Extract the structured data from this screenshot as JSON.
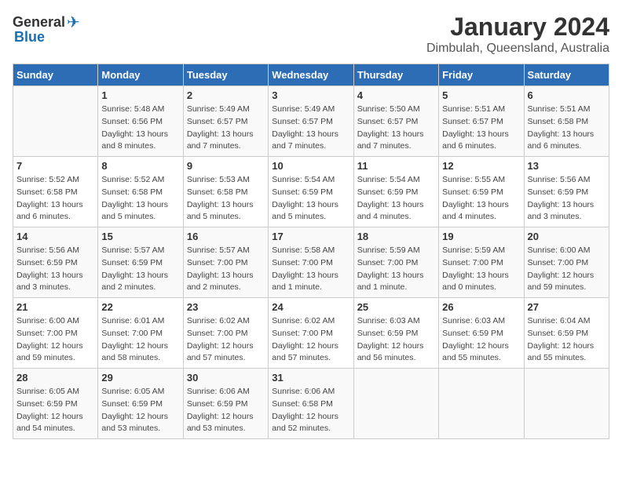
{
  "header": {
    "logo": {
      "general": "General",
      "blue": "Blue"
    },
    "title": "January 2024",
    "location": "Dimbulah, Queensland, Australia"
  },
  "calendar": {
    "days_of_week": [
      "Sunday",
      "Monday",
      "Tuesday",
      "Wednesday",
      "Thursday",
      "Friday",
      "Saturday"
    ],
    "weeks": [
      [
        {
          "day": "",
          "info": ""
        },
        {
          "day": "1",
          "info": "Sunrise: 5:48 AM\nSunset: 6:56 PM\nDaylight: 13 hours\nand 8 minutes."
        },
        {
          "day": "2",
          "info": "Sunrise: 5:49 AM\nSunset: 6:57 PM\nDaylight: 13 hours\nand 7 minutes."
        },
        {
          "day": "3",
          "info": "Sunrise: 5:49 AM\nSunset: 6:57 PM\nDaylight: 13 hours\nand 7 minutes."
        },
        {
          "day": "4",
          "info": "Sunrise: 5:50 AM\nSunset: 6:57 PM\nDaylight: 13 hours\nand 7 minutes."
        },
        {
          "day": "5",
          "info": "Sunrise: 5:51 AM\nSunset: 6:57 PM\nDaylight: 13 hours\nand 6 minutes."
        },
        {
          "day": "6",
          "info": "Sunrise: 5:51 AM\nSunset: 6:58 PM\nDaylight: 13 hours\nand 6 minutes."
        }
      ],
      [
        {
          "day": "7",
          "info": "Sunrise: 5:52 AM\nSunset: 6:58 PM\nDaylight: 13 hours\nand 6 minutes."
        },
        {
          "day": "8",
          "info": "Sunrise: 5:52 AM\nSunset: 6:58 PM\nDaylight: 13 hours\nand 5 minutes."
        },
        {
          "day": "9",
          "info": "Sunrise: 5:53 AM\nSunset: 6:58 PM\nDaylight: 13 hours\nand 5 minutes."
        },
        {
          "day": "10",
          "info": "Sunrise: 5:54 AM\nSunset: 6:59 PM\nDaylight: 13 hours\nand 5 minutes."
        },
        {
          "day": "11",
          "info": "Sunrise: 5:54 AM\nSunset: 6:59 PM\nDaylight: 13 hours\nand 4 minutes."
        },
        {
          "day": "12",
          "info": "Sunrise: 5:55 AM\nSunset: 6:59 PM\nDaylight: 13 hours\nand 4 minutes."
        },
        {
          "day": "13",
          "info": "Sunrise: 5:56 AM\nSunset: 6:59 PM\nDaylight: 13 hours\nand 3 minutes."
        }
      ],
      [
        {
          "day": "14",
          "info": "Sunrise: 5:56 AM\nSunset: 6:59 PM\nDaylight: 13 hours\nand 3 minutes."
        },
        {
          "day": "15",
          "info": "Sunrise: 5:57 AM\nSunset: 6:59 PM\nDaylight: 13 hours\nand 2 minutes."
        },
        {
          "day": "16",
          "info": "Sunrise: 5:57 AM\nSunset: 7:00 PM\nDaylight: 13 hours\nand 2 minutes."
        },
        {
          "day": "17",
          "info": "Sunrise: 5:58 AM\nSunset: 7:00 PM\nDaylight: 13 hours\nand 1 minute."
        },
        {
          "day": "18",
          "info": "Sunrise: 5:59 AM\nSunset: 7:00 PM\nDaylight: 13 hours\nand 1 minute."
        },
        {
          "day": "19",
          "info": "Sunrise: 5:59 AM\nSunset: 7:00 PM\nDaylight: 13 hours\nand 0 minutes."
        },
        {
          "day": "20",
          "info": "Sunrise: 6:00 AM\nSunset: 7:00 PM\nDaylight: 12 hours\nand 59 minutes."
        }
      ],
      [
        {
          "day": "21",
          "info": "Sunrise: 6:00 AM\nSunset: 7:00 PM\nDaylight: 12 hours\nand 59 minutes."
        },
        {
          "day": "22",
          "info": "Sunrise: 6:01 AM\nSunset: 7:00 PM\nDaylight: 12 hours\nand 58 minutes."
        },
        {
          "day": "23",
          "info": "Sunrise: 6:02 AM\nSunset: 7:00 PM\nDaylight: 12 hours\nand 57 minutes."
        },
        {
          "day": "24",
          "info": "Sunrise: 6:02 AM\nSunset: 7:00 PM\nDaylight: 12 hours\nand 57 minutes."
        },
        {
          "day": "25",
          "info": "Sunrise: 6:03 AM\nSunset: 6:59 PM\nDaylight: 12 hours\nand 56 minutes."
        },
        {
          "day": "26",
          "info": "Sunrise: 6:03 AM\nSunset: 6:59 PM\nDaylight: 12 hours\nand 55 minutes."
        },
        {
          "day": "27",
          "info": "Sunrise: 6:04 AM\nSunset: 6:59 PM\nDaylight: 12 hours\nand 55 minutes."
        }
      ],
      [
        {
          "day": "28",
          "info": "Sunrise: 6:05 AM\nSunset: 6:59 PM\nDaylight: 12 hours\nand 54 minutes."
        },
        {
          "day": "29",
          "info": "Sunrise: 6:05 AM\nSunset: 6:59 PM\nDaylight: 12 hours\nand 53 minutes."
        },
        {
          "day": "30",
          "info": "Sunrise: 6:06 AM\nSunset: 6:59 PM\nDaylight: 12 hours\nand 53 minutes."
        },
        {
          "day": "31",
          "info": "Sunrise: 6:06 AM\nSunset: 6:58 PM\nDaylight: 12 hours\nand 52 minutes."
        },
        {
          "day": "",
          "info": ""
        },
        {
          "day": "",
          "info": ""
        },
        {
          "day": "",
          "info": ""
        }
      ]
    ]
  }
}
